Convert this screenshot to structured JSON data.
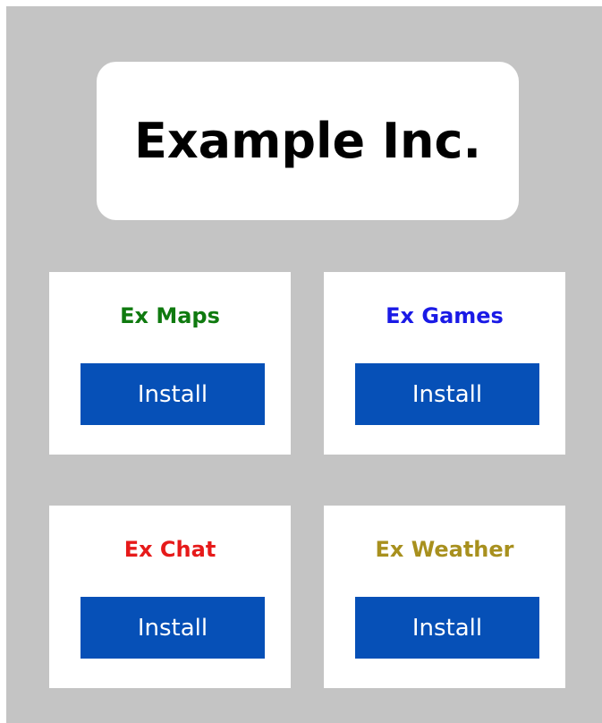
{
  "header": {
    "title": "Example Inc."
  },
  "apps": [
    {
      "name": "Ex Maps",
      "color": "#0f7a0f",
      "install_label": "Install"
    },
    {
      "name": "Ex Games",
      "color": "#1a1ae6",
      "install_label": "Install"
    },
    {
      "name": "Ex Chat",
      "color": "#e61a1a",
      "install_label": "Install"
    },
    {
      "name": "Ex Weather",
      "color": "#a8901e",
      "install_label": "Install"
    }
  ],
  "colors": {
    "background": "#c4c4c4",
    "card": "#ffffff",
    "button": "#0650b7",
    "button_text": "#ffffff"
  }
}
